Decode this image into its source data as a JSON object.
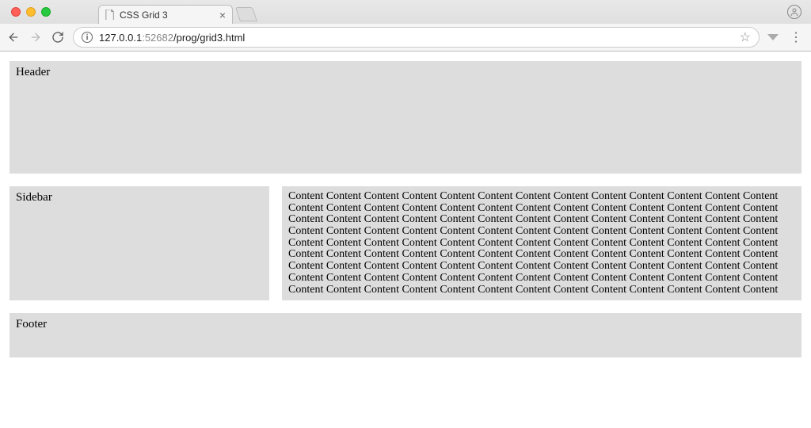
{
  "browser": {
    "tab_title": "CSS Grid 3",
    "url_host": "127.0.0.1",
    "url_port": ":52682",
    "url_path": "/prog/grid3.html",
    "info_i": "i"
  },
  "page": {
    "header": "Header",
    "sidebar": "Sidebar",
    "footer": "Footer",
    "content": "Content Content Content Content Content Content Content Content Content Content Content Content Content Content Content Content Content Content Content Content Content Content Content Content Content Content Content Content Content Content Content Content Content Content Content Content Content Content Content Content Content Content Content Content Content Content Content Content Content Content Content Content Content Content Content Content Content Content Content Content Content Content Content Content Content Content Content Content Content Content Content Content Content Content Content Content Content Content Content Content Content Content Content Content Content Content Content Content Content Content Content Content Content Content Content Content Content Content Content Content Content Content Content Content Content Content Content Content Content Content Content Content Content Content Content Content Content"
  }
}
